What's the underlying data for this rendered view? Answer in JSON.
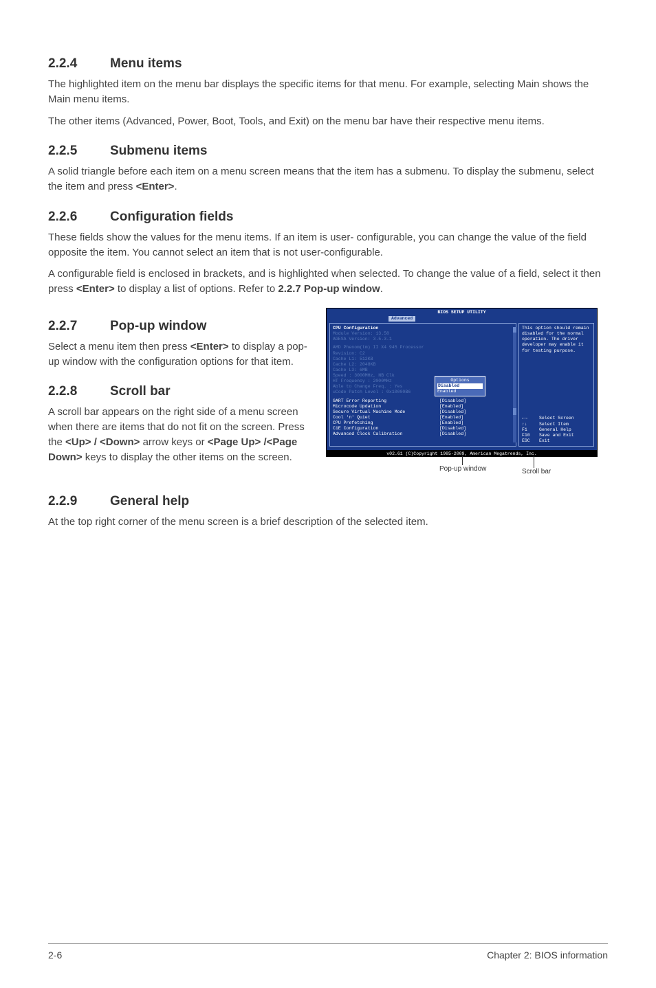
{
  "s224": {
    "num": "2.2.4",
    "title": "Menu items",
    "p1": "The highlighted item on the menu bar displays the specific items for that menu. For example, selecting Main shows the Main menu items.",
    "p2": "The other items (Advanced, Power, Boot, Tools, and Exit) on the menu bar have their respective menu items."
  },
  "s225": {
    "num": "2.2.5",
    "title": "Submenu items",
    "p1a": "A solid triangle before each item on a menu screen means that the item has a submenu. To display the submenu, select the item and press ",
    "p1b": "<Enter>",
    "p1c": "."
  },
  "s226": {
    "num": "2.2.6",
    "title": "Configuration fields",
    "p1": "These fields show the values for the menu items. If an item is user- configurable, you can change the value of the field opposite the item. You cannot select an item that is not user-configurable.",
    "p2a": "A configurable field is enclosed in brackets, and is highlighted when selected. To change the value of a field, select it then press ",
    "p2b": "<Enter>",
    "p2c": " to display a list of options. Refer to ",
    "p2d": "2.2.7 Pop-up window",
    "p2e": "."
  },
  "s227": {
    "num": "2.2.7",
    "title": "Pop-up window",
    "p1a": "Select a menu item then press ",
    "p1b": "<Enter>",
    "p1c": " to display a pop-up window with the configuration options for that item."
  },
  "s228": {
    "num": "2.2.8",
    "title": "Scroll bar",
    "p1a": "A scroll bar appears on the right side of a menu screen when there are items that do not fit on the screen. Press the ",
    "p1b": "<Up> / <Down>",
    "p1c": " arrow keys or ",
    "p1d": "<Page Up> /<Page Down>",
    "p1e": " keys to display the other items on the screen."
  },
  "s229": {
    "num": "2.2.9",
    "title": "General help",
    "p1": "At the top right corner of the menu screen is a brief description of the selected item."
  },
  "bios": {
    "title": "BIOS SETUP UTILITY",
    "tab": "Advanced",
    "header": "CPU Configuration",
    "module": "Module Version: 13.58",
    "agesa": "AGESA Version: 3.5.3.1",
    "cpu": "AMD Phenom(tm) II X4 945 Processor",
    "revision": "Revision: C2",
    "l1": "Cache L1: 512KB",
    "l2": "Cache L2: 2048KB",
    "l3": "Cache L3: 6MB",
    "speed": "Speed  : 3000MHz,  NB Clk",
    "ht": "HT Frequency : 2000MHz",
    "able": "Able to Change Freq. : Yes",
    "ucode": "uCode Patch Level    : 0x10000B6",
    "rows": [
      {
        "lbl": "GART Error Reporting",
        "val": "[Disabled]"
      },
      {
        "lbl": "Microcode Updation",
        "val": "[Enabled]"
      },
      {
        "lbl": "Secure Virtual Machine Mode",
        "val": "[Disabled]"
      },
      {
        "lbl": "Cool 'n' Quiet",
        "val": "[Enabled]"
      },
      {
        "lbl": "CPU Prefetching",
        "val": "[Enabled]"
      },
      {
        "lbl": "C1E Configuration",
        "val": "[Disabled]"
      },
      {
        "lbl": "Advanced Clock Calibration",
        "val": "[Disabled]"
      }
    ],
    "popup": {
      "title": "Options",
      "sel": "Disabled",
      "opt": "Enabled"
    },
    "help": "This option should remain disabled for the normal operation. The driver developer may enable it for testing purpose.",
    "nav": [
      {
        "k": "←→",
        "t": "Select Screen"
      },
      {
        "k": "↑↓",
        "t": "Select Item"
      },
      {
        "k": "F1",
        "t": "General Help"
      },
      {
        "k": "F10",
        "t": "Save and Exit"
      },
      {
        "k": "ESC",
        "t": "Exit"
      }
    ],
    "footer": "v02.61 (C)Copyright 1985-2009, American Megatrends, Inc.",
    "label_popup": "Pop-up window",
    "label_scroll": "Scroll bar"
  },
  "footer": {
    "left": "2-6",
    "right": "Chapter 2: BIOS information"
  }
}
